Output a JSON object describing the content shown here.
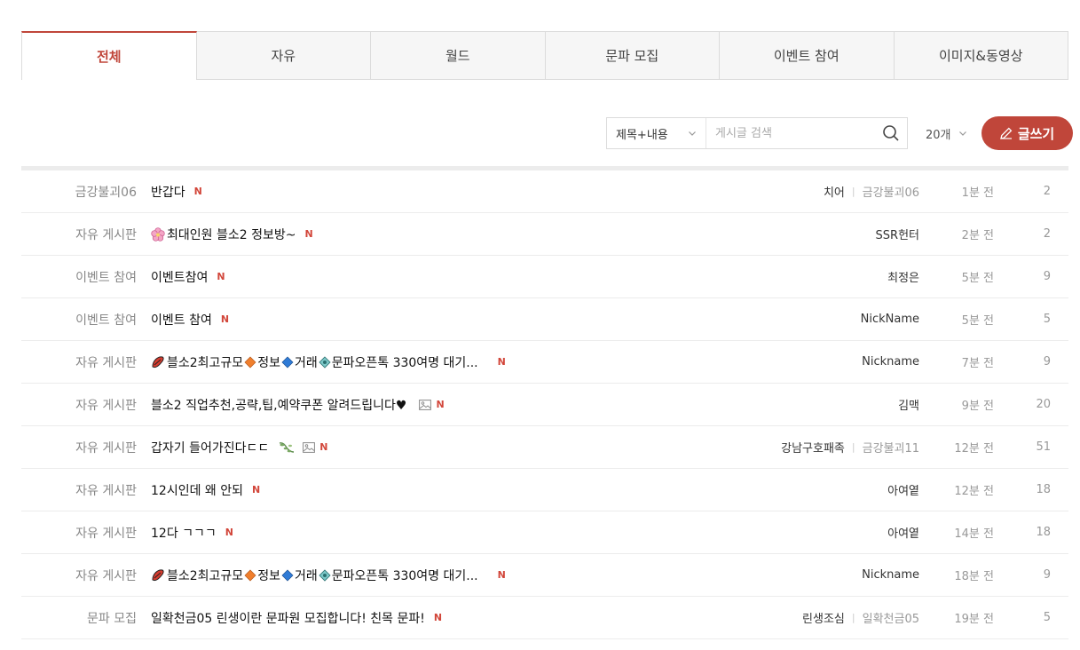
{
  "tabs": [
    {
      "label": "전체",
      "active": true
    },
    {
      "label": "자유",
      "active": false
    },
    {
      "label": "월드",
      "active": false
    },
    {
      "label": "문파 모집",
      "active": false
    },
    {
      "label": "이벤트 참여",
      "active": false
    },
    {
      "label": "이미지&동영상",
      "active": false
    }
  ],
  "toolbar": {
    "scope": "제목+내용",
    "search_placeholder": "게시글 검색",
    "page_size": "20개",
    "write_label": "글쓰기"
  },
  "colors": {
    "accent": "#c0463a",
    "new_badge": "#d2463a"
  },
  "posts": [
    {
      "category": "금강불괴06",
      "title": "반갑다",
      "author": "치어",
      "server": "금강불괴06",
      "time": "1분 전",
      "views": "2"
    },
    {
      "category": "자유 게시판",
      "title": "최대인원 블소2 정보방~",
      "author": "SSR헌터",
      "server": "",
      "time": "2분 전",
      "views": "2"
    },
    {
      "category": "이벤트 참여",
      "title": "이벤트참여",
      "author": "최정은",
      "server": "",
      "time": "5분 전",
      "views": "9"
    },
    {
      "category": "이벤트 참여",
      "title": "이벤트 참여",
      "author": "NickName",
      "server": "",
      "time": "5분 전",
      "views": "5"
    },
    {
      "category": "자유 게시판",
      "title_parts": [
        "블소2최고규모",
        "정보",
        "거래",
        "문파오픈톡 330여명 대기..."
      ],
      "author": "Nickname",
      "server": "",
      "time": "7분 전",
      "views": "9"
    },
    {
      "category": "자유 게시판",
      "title": "블소2 직업추천,공략,팁,예약쿠폰 알려드립니다♥",
      "author": "김맥",
      "server": "",
      "time": "9분 전",
      "views": "20"
    },
    {
      "category": "자유 게시판",
      "title": "갑자기 들어가진다ㄷㄷ",
      "author": "강남구호패족",
      "server": "금강불괴11",
      "time": "12분 전",
      "views": "51"
    },
    {
      "category": "자유 게시판",
      "title": "12시인데 왜 안되",
      "author": "아여옅",
      "server": "",
      "time": "12분 전",
      "views": "18"
    },
    {
      "category": "자유 게시판",
      "title": "12다 ㄱㄱㄱ",
      "author": "아여옅",
      "server": "",
      "time": "14분 전",
      "views": "18"
    },
    {
      "category": "자유 게시판",
      "title_parts": [
        "블소2최고규모",
        "정보",
        "거래",
        "문파오픈톡 330여명 대기..."
      ],
      "author": "Nickname",
      "server": "",
      "time": "18분 전",
      "views": "9"
    },
    {
      "category": "문파 모집",
      "title": "일확천금05 린생이란 문파원 모집합니다! 친목 문파!",
      "author": "린생조심",
      "server": "일확천금05",
      "time": "19분 전",
      "views": "5"
    }
  ],
  "badges": {
    "new": "N"
  }
}
